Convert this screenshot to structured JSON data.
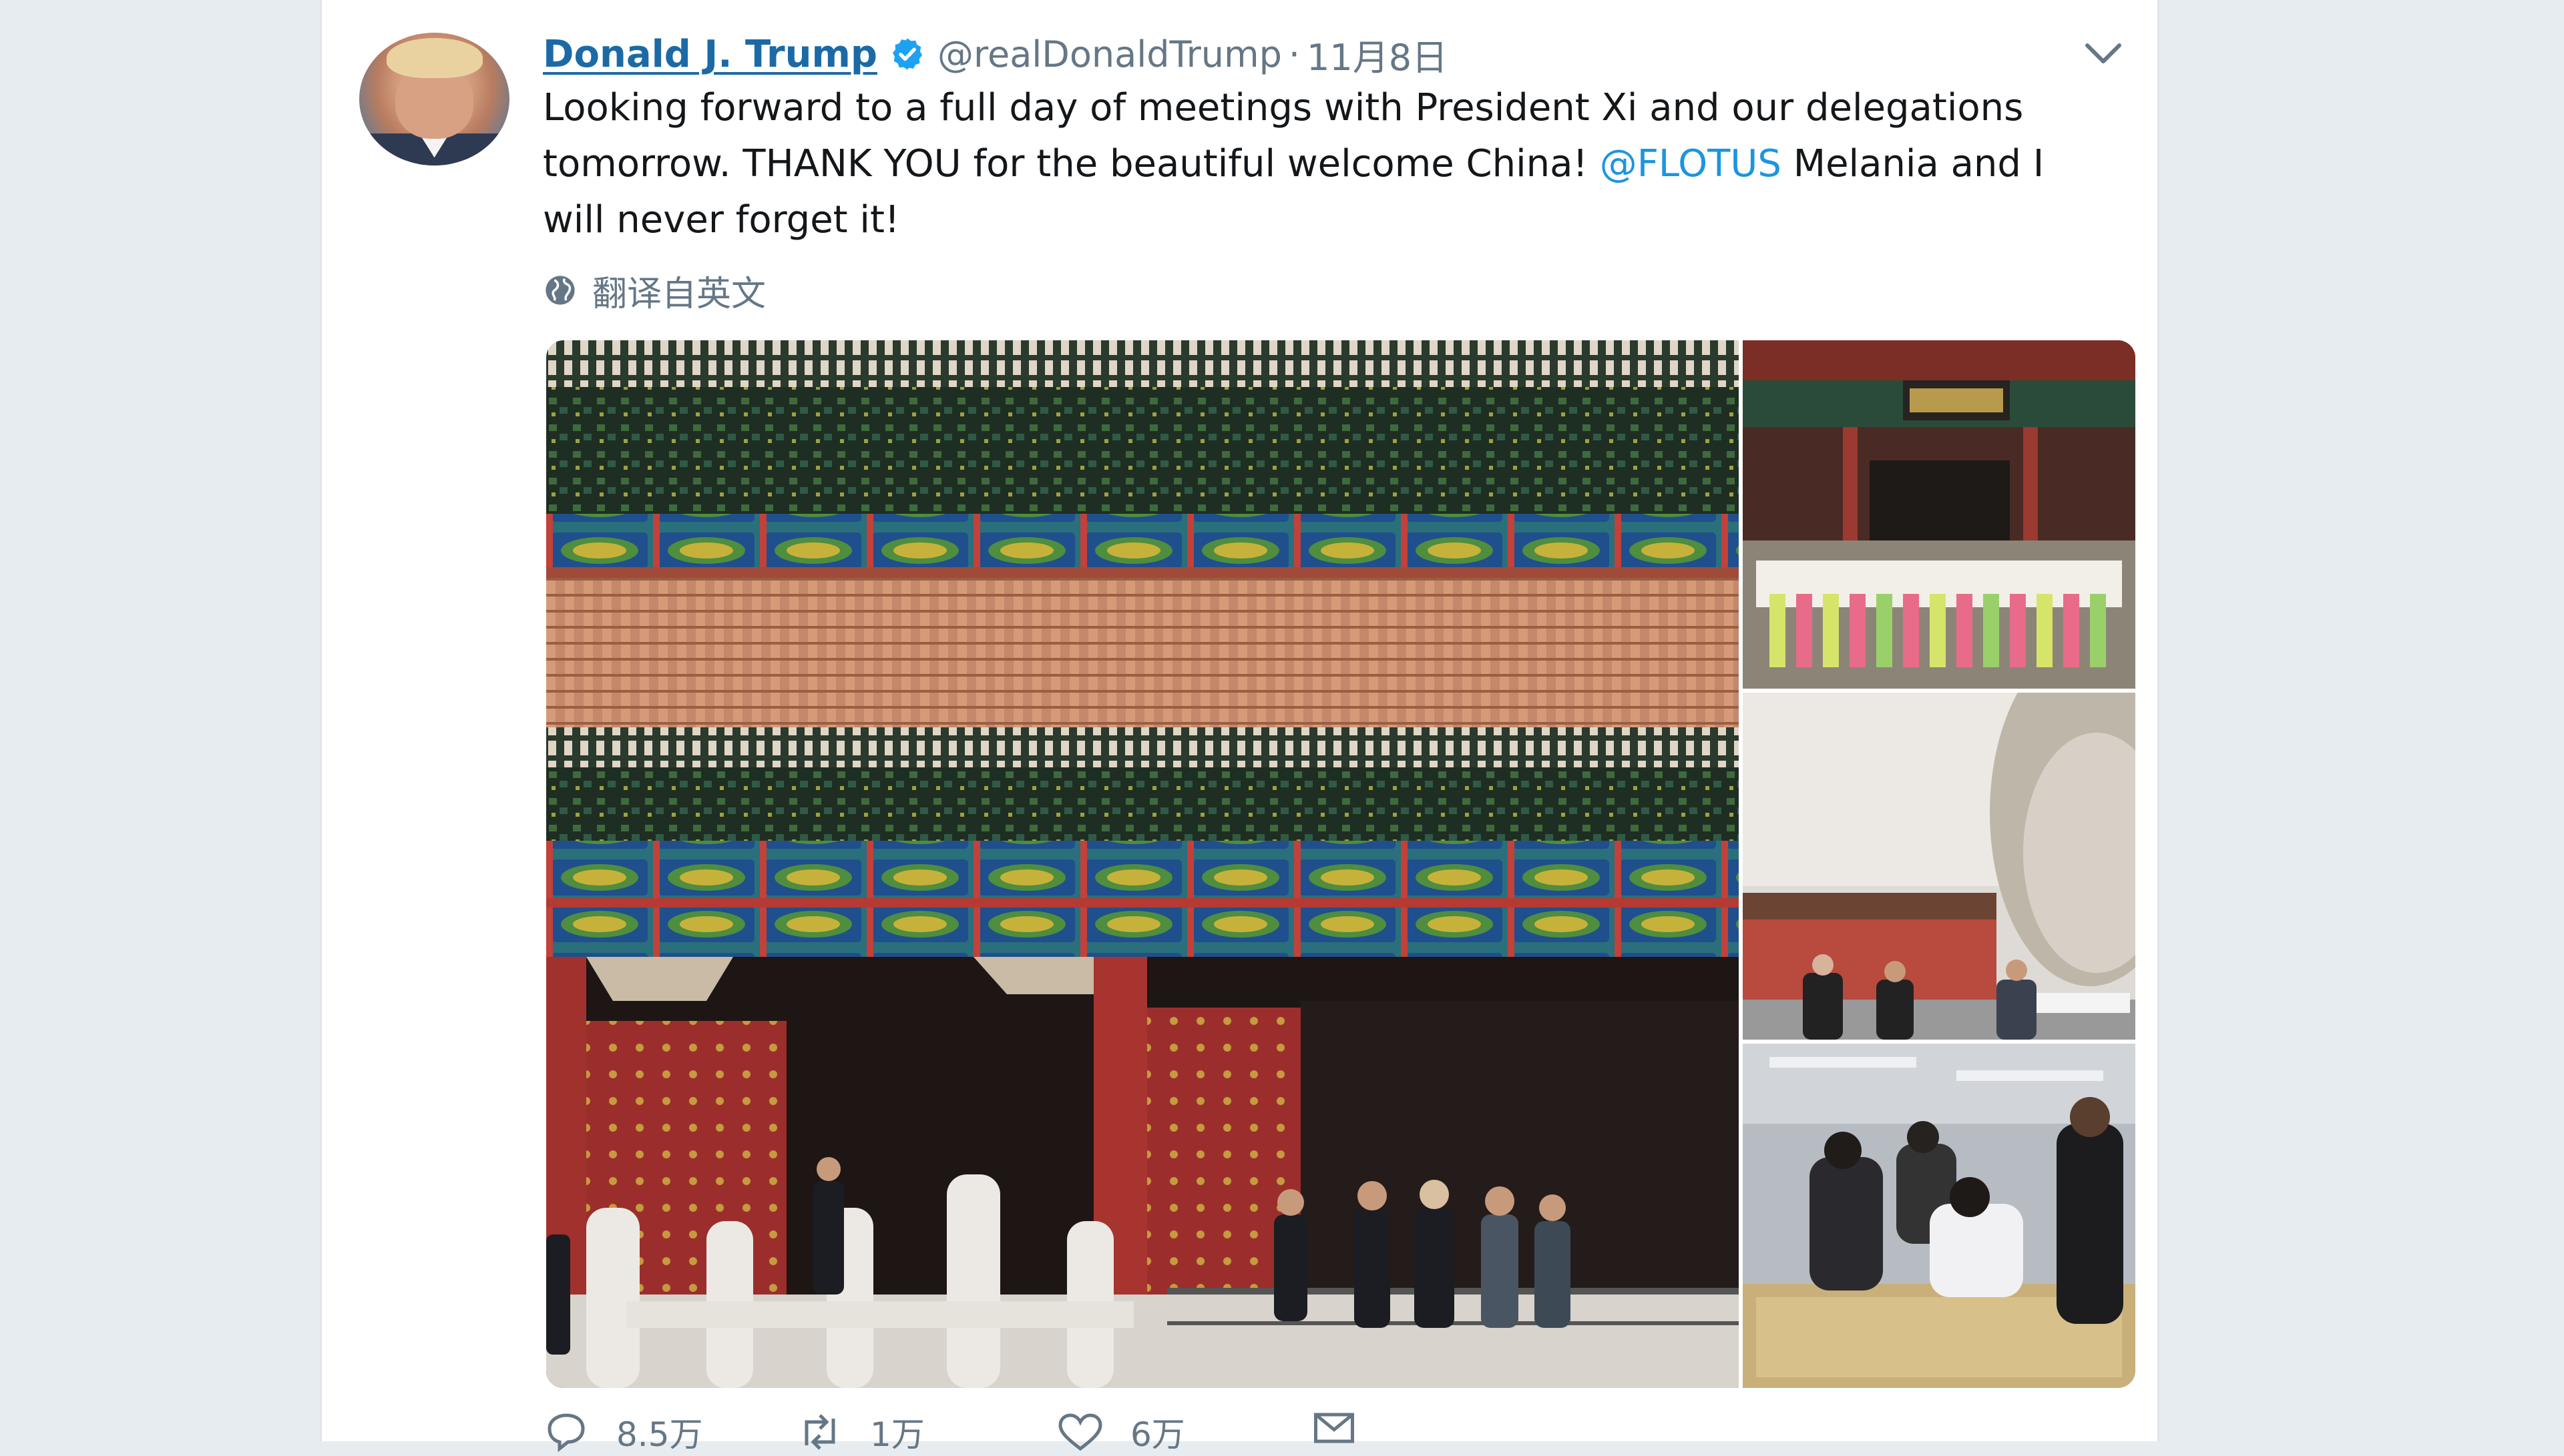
{
  "tweet": {
    "display_name": "Donald J. Trump",
    "handle": "@realDonaldTrump",
    "separator": "·",
    "date": "11月8日",
    "text_lines": [
      "Looking forward to a full day of meetings with President Xi and our delegations",
      "tomorrow. THANK YOU for the beautiful welcome China! ",
      "will never forget it!"
    ],
    "mention": "@FLOTUS",
    "after_mention": " Melania and I",
    "translate_label": "翻译自英文"
  },
  "actions": {
    "reply_count": "8.5万",
    "retweet_count": "1万",
    "like_count": "6万"
  },
  "colors": {
    "name": "#1b6aa6",
    "mention": "#1b95e0",
    "muted": "#657786",
    "verified": "#1da1f2"
  },
  "icons": [
    "verified-badge-icon",
    "chevron-down-icon",
    "globe-icon",
    "reply-icon",
    "retweet-icon",
    "like-icon",
    "direct-message-icon"
  ]
}
